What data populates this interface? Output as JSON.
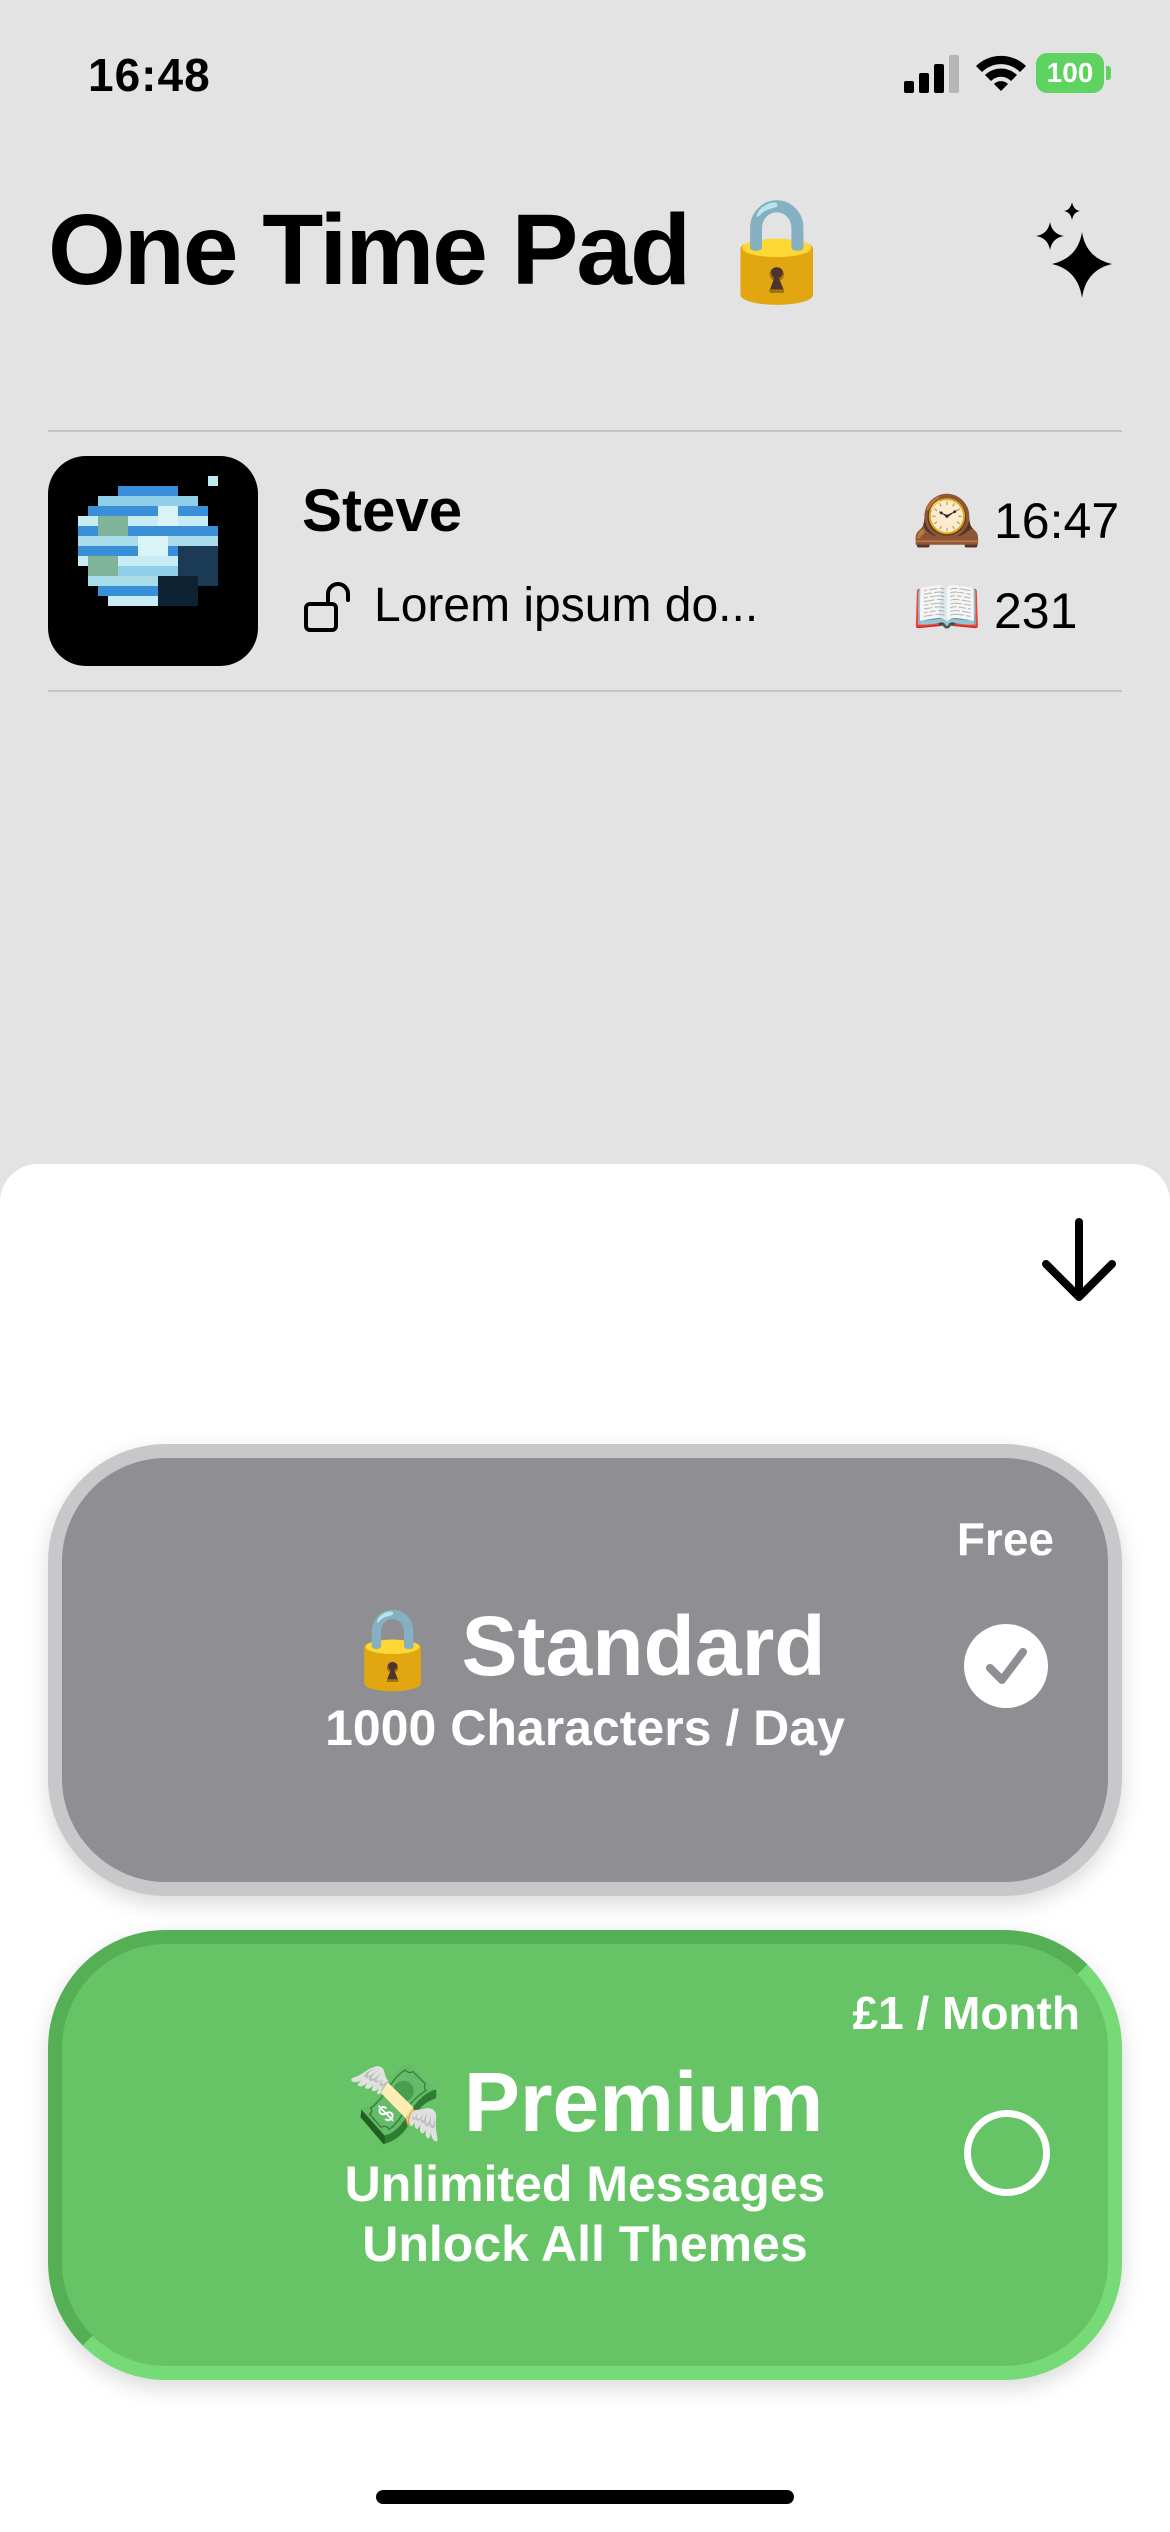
{
  "status_bar": {
    "time": "16:48",
    "battery": "100",
    "signal_icon": "cellular-signal-icon",
    "wifi_icon": "wifi-icon"
  },
  "header": {
    "title": "One Time Pad",
    "title_emoji": "🔒",
    "action_icon": "sparkles-icon"
  },
  "conversation": {
    "name": "Steve",
    "preview": "Lorem ipsum do...",
    "lock_icon": "unlocked-icon",
    "time_emoji": "🕰️",
    "time": "16:47",
    "count_emoji": "📖",
    "count": "231",
    "avatar_icon": "pixel-earth-icon"
  },
  "sheet": {
    "dismiss_icon": "arrow-down-icon",
    "plans": {
      "standard": {
        "price": "Free",
        "emoji": "🔒",
        "title": "Standard",
        "subtitle": "1000 Characters / Day",
        "selected": true
      },
      "premium": {
        "price": "£1 / Month",
        "emoji": "💸",
        "title": "Premium",
        "subtitle_line1": "Unlimited Messages",
        "subtitle_line2": "Unlock All Themes",
        "selected": false
      }
    }
  },
  "colors": {
    "background": "#e3e3e3",
    "standard_card": "#8e8e93",
    "premium_card": "#66c466",
    "battery": "#5fd35f"
  }
}
